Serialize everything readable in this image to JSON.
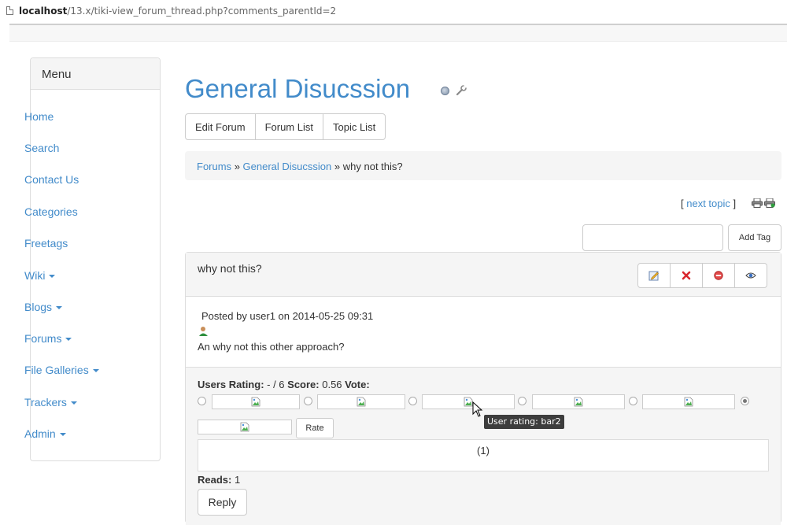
{
  "browser": {
    "url_host": "localhost",
    "url_path": "/13.x/tiki-view_forum_thread.php?comments_parentId=2"
  },
  "sidebar": {
    "heading": "Menu",
    "items": [
      {
        "label": "Home",
        "dropdown": false
      },
      {
        "label": "Search",
        "dropdown": false
      },
      {
        "label": "Contact Us",
        "dropdown": false
      },
      {
        "label": "Categories",
        "dropdown": false
      },
      {
        "label": "Freetags",
        "dropdown": false
      },
      {
        "label": "Wiki",
        "dropdown": true
      },
      {
        "label": "Blogs",
        "dropdown": true
      },
      {
        "label": "Forums",
        "dropdown": true
      },
      {
        "label": "File Galleries",
        "dropdown": true
      },
      {
        "label": "Trackers",
        "dropdown": true
      },
      {
        "label": "Admin",
        "dropdown": true
      }
    ]
  },
  "page": {
    "title": "General Disucssion",
    "title_icons": [
      "monitor-icon",
      "wrench-icon"
    ]
  },
  "toolbar": {
    "edit_forum": "Edit Forum",
    "forum_list": "Forum List",
    "topic_list": "Topic List"
  },
  "breadcrumb": {
    "forums": "Forums",
    "sep": "»",
    "forum": "General Disucssion",
    "current": "why not this?"
  },
  "nav": {
    "open_bracket": "[",
    "next_topic": "next topic",
    "close_bracket": "]",
    "icons": [
      "print-icon",
      "print-all-icon"
    ]
  },
  "tags": {
    "input_value": "",
    "add_label": "Add Tag"
  },
  "post": {
    "title": "why not this?",
    "actions": [
      "edit-icon",
      "delete-icon",
      "unlock-icon",
      "view-icon"
    ],
    "posted_by": "Posted by user1 on 2014-05-25 09:31",
    "body": "An why not this other approach?"
  },
  "rating": {
    "users_rating_label": "Users Rating:",
    "users_rating_value": " - / 6 ",
    "score_label": "Score:",
    "score_value": " 0.56 ",
    "vote_label": "Vote:",
    "selected_option": 6,
    "rate_label": "Rate",
    "count_text": "(1)",
    "reads_label": "Reads:",
    "reads_value": " 1",
    "reply_label": "Reply"
  },
  "tooltip": {
    "text": "User rating: bar2"
  },
  "colors": {
    "link": "#428bca",
    "panel_bg": "#f5f5f5",
    "border": "#dddddd"
  }
}
